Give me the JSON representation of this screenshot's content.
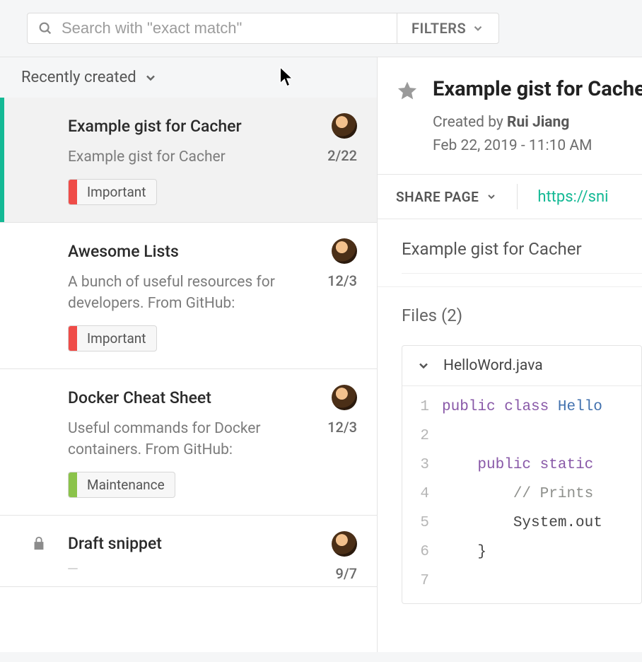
{
  "search": {
    "placeholder": "Search with \"exact match\"",
    "filters_label": "FILTERS"
  },
  "sort": {
    "label": "Recently created"
  },
  "gists": [
    {
      "title": "Example gist for Cacher",
      "description": "Example gist for Cacher",
      "date": "2/22",
      "private": false,
      "tags": [
        {
          "label": "Important",
          "color": "#ef4c48"
        }
      ],
      "selected": true
    },
    {
      "title": "Awesome Lists",
      "description": "A bunch of useful resources for developers. From GitHub:",
      "date": "12/3",
      "private": false,
      "tags": [
        {
          "label": "Important",
          "color": "#ef4c48"
        }
      ],
      "selected": false
    },
    {
      "title": "Docker Cheat Sheet",
      "description": "Useful commands for Docker containers. From GitHub:",
      "date": "12/3",
      "private": false,
      "tags": [
        {
          "label": "Maintenance",
          "color": "#8bc34a"
        }
      ],
      "selected": false
    },
    {
      "title": "Draft snippet",
      "description": "",
      "date": "9/7",
      "private": true,
      "tags": [
        {
          "label": "",
          "color": "#ef4c48"
        }
      ],
      "selected": false
    }
  ],
  "detail": {
    "title": "Example gist for Cacher",
    "created_prefix": "Created by ",
    "author": "Rui Jiang",
    "timestamp": "Feb 22, 2019 - 11:10 AM",
    "share_label": "SHARE PAGE",
    "share_url": "https://sni",
    "description": "Example gist for Cacher",
    "files_label": "Files (2)",
    "file": {
      "name": "HelloWord.java",
      "code_lines": [
        [
          {
            "t": "kw",
            "v": "public"
          },
          {
            "t": "sp",
            "v": " "
          },
          {
            "t": "kw",
            "v": "class"
          },
          {
            "t": "sp",
            "v": " "
          },
          {
            "t": "id",
            "v": "Hello"
          }
        ],
        [],
        [
          {
            "t": "sp",
            "v": "    "
          },
          {
            "t": "kw",
            "v": "public"
          },
          {
            "t": "sp",
            "v": " "
          },
          {
            "t": "kw",
            "v": "static"
          }
        ],
        [
          {
            "t": "sp",
            "v": "        "
          },
          {
            "t": "cm",
            "v": "// Prints"
          }
        ],
        [
          {
            "t": "sp",
            "v": "        "
          },
          {
            "t": "pl",
            "v": "System.out"
          }
        ],
        [
          {
            "t": "sp",
            "v": "    "
          },
          {
            "t": "pl",
            "v": "}"
          }
        ],
        []
      ]
    }
  }
}
